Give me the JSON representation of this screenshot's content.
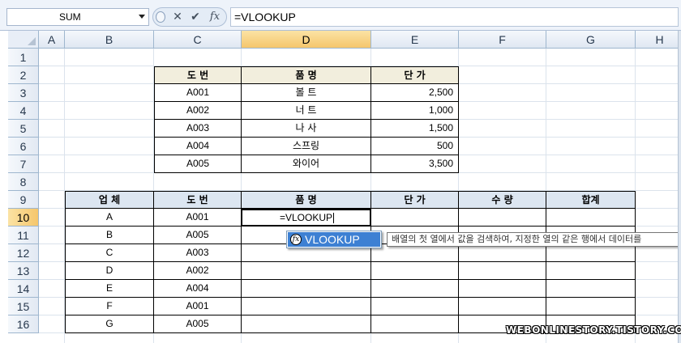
{
  "formula_bar": {
    "name_box": "SUM",
    "cancel_glyph": "✕",
    "enter_glyph": "✔",
    "fx_glyph": "fx",
    "formula": "=VLOOKUP"
  },
  "columns": [
    "A",
    "B",
    "C",
    "D",
    "E",
    "F",
    "G",
    "H"
  ],
  "selected_column": "D",
  "rows": [
    "1",
    "2",
    "3",
    "4",
    "5",
    "6",
    "7",
    "8",
    "9",
    "10",
    "11",
    "12",
    "13",
    "14",
    "15",
    "16"
  ],
  "selected_row": "10",
  "lookup_table": {
    "headers": [
      "도  번",
      "품  명",
      "단  가"
    ],
    "rows": [
      [
        "A001",
        "볼  트",
        "2,500"
      ],
      [
        "A002",
        "너  트",
        "1,000"
      ],
      [
        "A003",
        "나  사",
        "1,500"
      ],
      [
        "A004",
        "스프링",
        "500"
      ],
      [
        "A005",
        "와이어",
        "3,500"
      ]
    ]
  },
  "order_table": {
    "headers": [
      "업  체",
      "도  번",
      "품  명",
      "단  가",
      "수  량",
      "합계"
    ],
    "rows": [
      [
        "A",
        "A001"
      ],
      [
        "B",
        "A005"
      ],
      [
        "C",
        "A003"
      ],
      [
        "D",
        "A002"
      ],
      [
        "E",
        "A004"
      ],
      [
        "F",
        "A001"
      ],
      [
        "G",
        "A005"
      ]
    ]
  },
  "active_cell_value": "=VLOOKUP",
  "autocomplete": {
    "item": "VLOOKUP",
    "tooltip": "배열의 첫 열에서 값을 검색하여, 지정한 열의 같은 행에서 데이터를"
  },
  "watermark": "WEBONLINESTORY.TISTORY.COM",
  "colors": {
    "header_tan": "#f2eedd",
    "header_blue": "#dce6f1",
    "selection": "#f5c66c",
    "autocomplete_highlight": "#3d80d3"
  }
}
